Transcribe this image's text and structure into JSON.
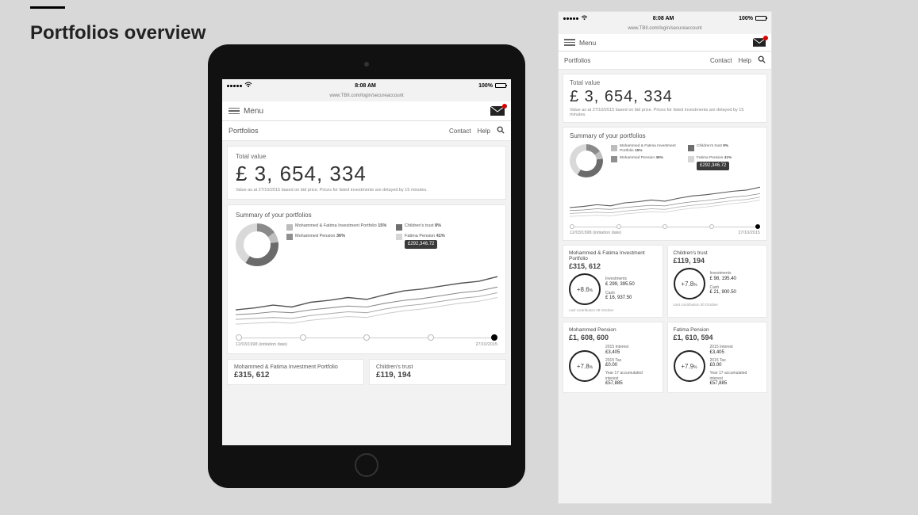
{
  "page": {
    "title": "Portfolios overview"
  },
  "status": {
    "time": "8:08 AM",
    "battery": "100%"
  },
  "url": "www.TBII.com/login/secureaccount",
  "menu_label": "Menu",
  "subheader": {
    "title": "Portfolios",
    "contact": "Contact",
    "help": "Help"
  },
  "total": {
    "label": "Total value",
    "value": "£ 3, 654, 334",
    "note": "Value as at 27/10/2015 based on bid price. Prices for listed investments are delayed by 15 minutes."
  },
  "summary_title": "Summary of your portfolios",
  "legend": [
    {
      "name": "Mohammed & Fatima Investment Portfolio",
      "pct": "15%",
      "color": "#bcbcbc"
    },
    {
      "name": "Children's trust",
      "pct": "8%",
      "color": "#6e6e6e"
    },
    {
      "name": "Mohammed Pension",
      "pct": "36%",
      "color": "#8f8f8f"
    },
    {
      "name": "Fatima Pension",
      "pct": "41%",
      "color": "#d6d6d6"
    }
  ],
  "tooltip": "£292,346.72",
  "timeline": {
    "start": "12/03/1998 (initiation date)",
    "end": "27/10/2015"
  },
  "portfolios": [
    {
      "name": "Mohammed & Fatima Investment Portfolio",
      "value": "£315, 612",
      "change": "+8.6",
      "rows": [
        {
          "label": "Investments",
          "value": "£ 299, 395.50"
        },
        {
          "label": "Cash",
          "value": "£ 16, 937.50"
        }
      ],
      "footnote": "Last contribution 28 October"
    },
    {
      "name": "Children's trust",
      "value": "£119, 194",
      "change": "+7.8",
      "rows": [
        {
          "label": "Investments",
          "value": "£ 98, 195.40"
        },
        {
          "label": "Cash",
          "value": "£ 21, 900.50"
        }
      ],
      "footnote": "Last contribution 30 October"
    },
    {
      "name": "Mohammed Pension",
      "value": "£1, 608, 600",
      "change": "+7.8",
      "rows": [
        {
          "label": "2015 Interest",
          "value": "£3,405"
        },
        {
          "label": "2015 Tax",
          "value": "£0.00"
        },
        {
          "label": "Year 17 accumulated interest",
          "value": "£57,885"
        }
      ],
      "footnote": ""
    },
    {
      "name": "Fatima Pension",
      "value": "£1, 610, 594",
      "change": "+7.9",
      "rows": [
        {
          "label": "2015 Interest",
          "value": "£3,405"
        },
        {
          "label": "2015 Tax",
          "value": "£0.00"
        },
        {
          "label": "Year 17 accumulated interest",
          "value": "£57,885"
        }
      ],
      "footnote": ""
    }
  ],
  "chart_data": {
    "type": "line",
    "x_range": [
      "12/03/1998",
      "27/10/2015"
    ],
    "series": [
      {
        "name": "Mohammed & Fatima Investment Portfolio",
        "values": [
          20,
          22,
          25,
          23,
          28,
          30,
          33,
          31,
          36,
          40,
          42,
          45,
          48,
          50,
          55
        ]
      },
      {
        "name": "Children's trust",
        "values": [
          15,
          16,
          18,
          17,
          20,
          22,
          24,
          23,
          27,
          30,
          32,
          35,
          38,
          40,
          44
        ]
      },
      {
        "name": "Mohammed Pension",
        "values": [
          10,
          11,
          12,
          11,
          14,
          16,
          18,
          17,
          21,
          24,
          26,
          29,
          32,
          34,
          38
        ]
      },
      {
        "name": "Fatima Pension",
        "values": [
          5,
          6,
          7,
          6,
          9,
          11,
          13,
          12,
          16,
          19,
          21,
          24,
          27,
          29,
          33
        ]
      }
    ],
    "timeline_nodes": 5,
    "active_node_index": 4
  }
}
